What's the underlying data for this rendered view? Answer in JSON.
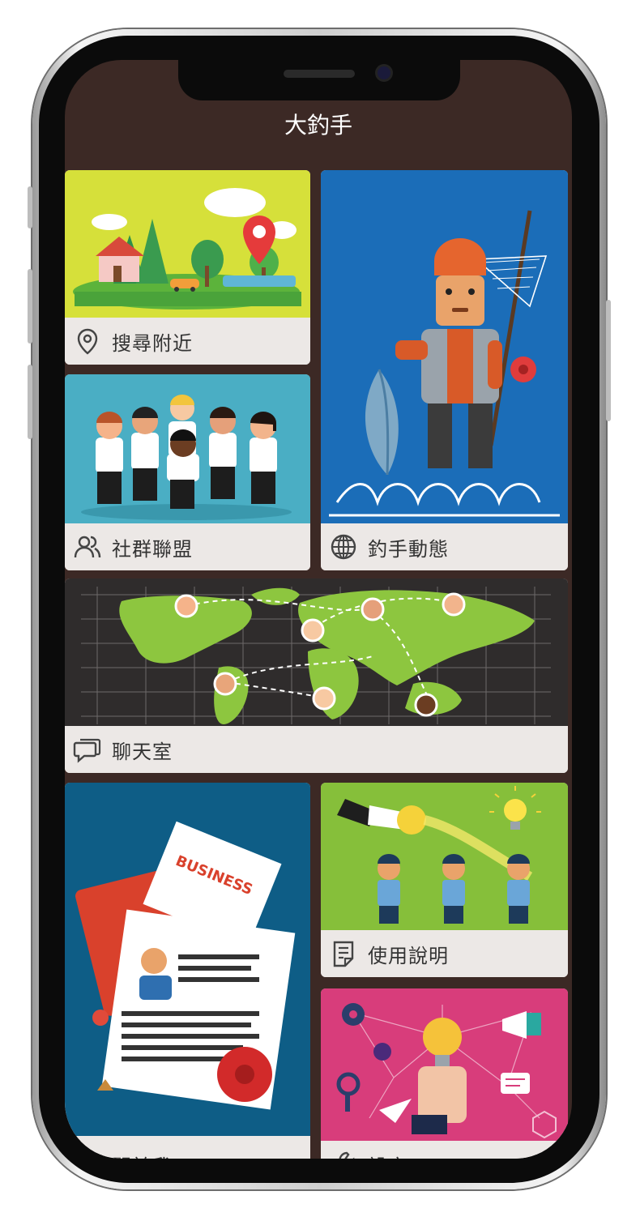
{
  "app": {
    "title": "大釣手"
  },
  "tiles": {
    "nearby": {
      "label": "搜尋附近",
      "icon": "map-pin-icon"
    },
    "community": {
      "label": "社群聯盟",
      "icon": "users-icon"
    },
    "angler_news": {
      "label": "釣手動態",
      "icon": "globe-icon"
    },
    "chat": {
      "label": "聊天室",
      "icon": "chat-bubble-icon"
    },
    "about": {
      "label": "關於我",
      "icon": "user-icon"
    },
    "help": {
      "label": "使用說明",
      "icon": "document-icon"
    },
    "settings": {
      "label": "設定",
      "icon": "wrench-icon"
    }
  },
  "colors": {
    "background": "#3c2925",
    "tile_label_bg": "#ece8e6",
    "nearby_art": "#d6e03a",
    "community_art": "#4aaec4",
    "angler_art": "#1b6db8",
    "chat_art": "#2f2c2c",
    "about_art": "#0e5d86",
    "help_art": "#86bf3a",
    "settings_art": "#d83d7b"
  }
}
